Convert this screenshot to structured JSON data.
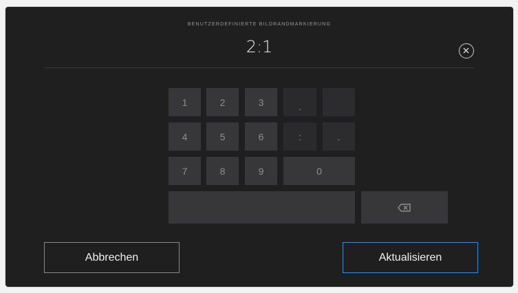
{
  "dialog": {
    "title": "BENUTZERDEFINIERTE BILDRANDMARKIERUNG",
    "value": "2:1"
  },
  "keypad": {
    "keys": [
      "1",
      "2",
      "3",
      ".",
      "",
      "4",
      "5",
      "6",
      ":",
      ".",
      "7",
      "8",
      "9",
      "0"
    ],
    "backspace_icon": "backspace-icon"
  },
  "buttons": {
    "cancel_label": "Abbrechen",
    "update_label": "Aktualisieren"
  },
  "colors": {
    "background": "#1f1f20",
    "key": "#37373a",
    "accent": "#3a8bd6"
  }
}
